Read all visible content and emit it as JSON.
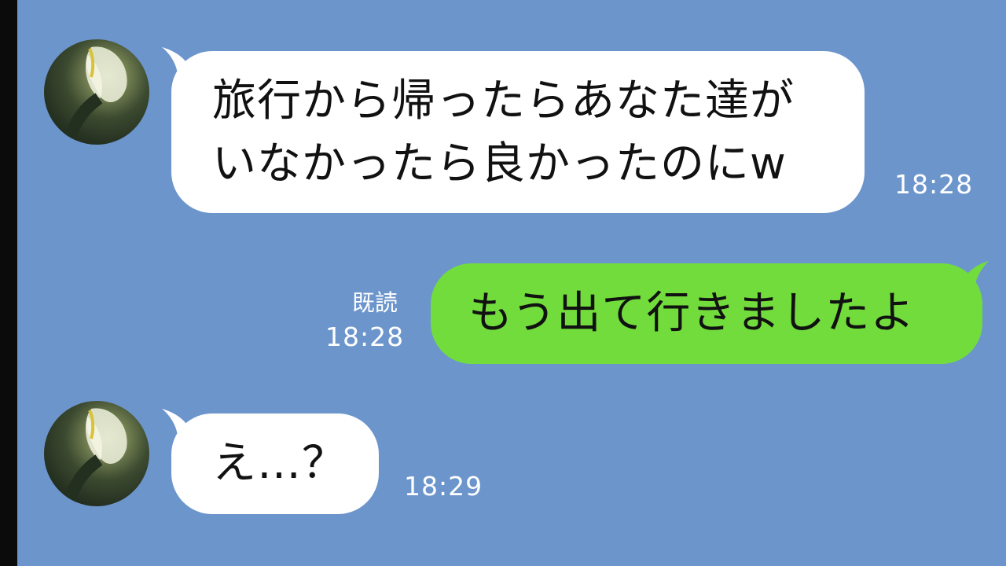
{
  "chat": {
    "messages": [
      {
        "side": "incoming",
        "lines": [
          "旅行から帰ったらあなた達が",
          "いなかったら良かったのにw"
        ],
        "time": "18:28"
      },
      {
        "side": "outgoing",
        "lines": [
          "もう出て行きましたよ"
        ],
        "read_label": "既読",
        "time": "18:28"
      },
      {
        "side": "incoming",
        "lines": [
          "え…？"
        ],
        "time": "18:29"
      }
    ]
  },
  "colors": {
    "background": "#6c95cc",
    "incoming_bubble": "#ffffff",
    "outgoing_bubble": "#72dc3c",
    "timestamp_text": "#ffffff"
  },
  "icons": {
    "avatar": "flower-photo-avatar"
  }
}
